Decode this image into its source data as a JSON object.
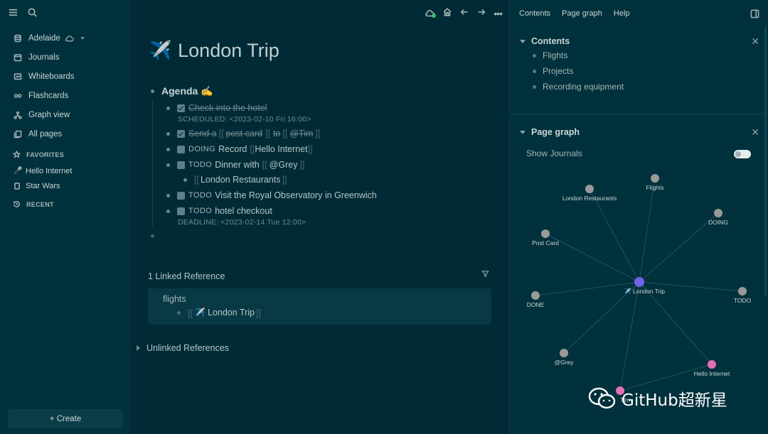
{
  "sidebar": {
    "graph_name": "Adelaide",
    "nav": [
      {
        "label": "Journals"
      },
      {
        "label": "Whiteboards"
      },
      {
        "label": "Flashcards"
      },
      {
        "label": "Graph view"
      },
      {
        "label": "All pages"
      }
    ],
    "favorites_label": "FAVORITES",
    "favorites": [
      {
        "label": "Hello Internet"
      },
      {
        "label": "Star Wars"
      }
    ],
    "recent_label": "RECENT",
    "create_label": "+ Create"
  },
  "page": {
    "title_icon": "✈️",
    "title": "London Trip",
    "agenda": "Agenda ✍️",
    "blocks": [
      {
        "marker": "",
        "text": "Check into the hotel"
      },
      {
        "meta": "SCHEDULED: <2023-02-10 Fri 16:00>"
      },
      {
        "t1": "Send a",
        "t2": "post card",
        "t3": "to",
        "t4": "@Tim"
      },
      {
        "marker": "DOING",
        "t1": "Record",
        "t2": "Hello Internet"
      },
      {
        "marker": "TODO",
        "t1": "Dinner with",
        "t2": "@Grey"
      },
      {
        "t1": "London Restaurants"
      },
      {
        "marker": "TODO",
        "t1": "Visit the Royal Observatory in Greenwich"
      },
      {
        "marker": "TODO",
        "t1": "hotel checkout"
      },
      {
        "meta": "DEADLINE: <2023-02-14 Tue 12:00>"
      }
    ],
    "linked_title": "1 Linked Reference",
    "linked_page": "flights",
    "linked_ref": "✈️ London Trip",
    "unlinked_title": "Unlinked References"
  },
  "right": {
    "tabs": [
      "Contents",
      "Page graph",
      "Help"
    ],
    "contents_title": "Contents",
    "contents": [
      "Flights",
      "Projects",
      "Recording equipment"
    ],
    "graph_title": "Page graph",
    "show_journals": "Show Journals",
    "graph_nodes": [
      {
        "label": "✈️ London Trip",
        "color": "#6f63e6"
      },
      {
        "label": "London Restaurants",
        "color": "#9a9a9a"
      },
      {
        "label": "Flights",
        "color": "#9a9a9a"
      },
      {
        "label": "DOING",
        "color": "#9a9a9a"
      },
      {
        "label": "Post Card",
        "color": "#9a9a9a"
      },
      {
        "label": "DONE",
        "color": "#9a9a9a"
      },
      {
        "label": "TODO",
        "color": "#9a9a9a"
      },
      {
        "label": "@Grey",
        "color": "#9a9a9a"
      },
      {
        "label": "Hello Internet",
        "color": "#e26fb5"
      },
      {
        "label": "Tim",
        "color": "#e26fb5"
      }
    ]
  },
  "watermark": "GitHub超新星"
}
